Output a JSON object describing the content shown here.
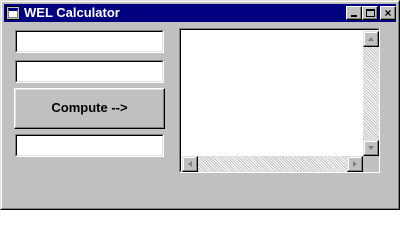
{
  "window": {
    "title": "WEL Calculator",
    "colors": {
      "titlebar": "#000080",
      "face": "#c0c0c0",
      "field": "#ffffff"
    }
  },
  "title_buttons": {
    "minimize_icon": "minimize-icon",
    "maximize_icon": "maximize-icon",
    "close_icon": "close-icon",
    "close_glyph": "×"
  },
  "inputs": {
    "first_value": "",
    "second_value": "",
    "result_value": ""
  },
  "compute_button": {
    "label": "Compute -->"
  },
  "output": {
    "text": ""
  }
}
